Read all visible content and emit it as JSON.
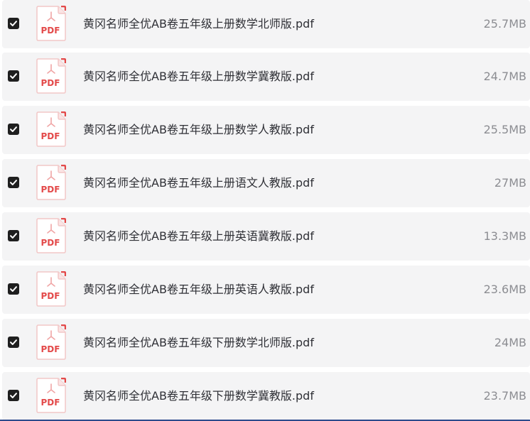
{
  "files": [
    {
      "name": "黄冈名师全优AB卷五年级上册数学北师版.pdf",
      "size": "25.7MB",
      "checked": true,
      "icon": "pdf-icon",
      "icon_text": "PDF"
    },
    {
      "name": "黄冈名师全优AB卷五年级上册数学冀教版.pdf",
      "size": "24.7MB",
      "checked": true,
      "icon": "pdf-icon",
      "icon_text": "PDF"
    },
    {
      "name": "黄冈名师全优AB卷五年级上册数学人教版.pdf",
      "size": "25.5MB",
      "checked": true,
      "icon": "pdf-icon",
      "icon_text": "PDF"
    },
    {
      "name": "黄冈名师全优AB卷五年级上册语文人教版.pdf",
      "size": "27MB",
      "checked": true,
      "icon": "pdf-icon",
      "icon_text": "PDF"
    },
    {
      "name": "黄冈名师全优AB卷五年级上册英语冀教版.pdf",
      "size": "13.3MB",
      "checked": true,
      "icon": "pdf-icon",
      "icon_text": "PDF"
    },
    {
      "name": "黄冈名师全优AB卷五年级上册英语人教版.pdf",
      "size": "23.6MB",
      "checked": true,
      "icon": "pdf-icon",
      "icon_text": "PDF"
    },
    {
      "name": "黄冈名师全优AB卷五年级下册数学北师版.pdf",
      "size": "24MB",
      "checked": true,
      "icon": "pdf-icon",
      "icon_text": "PDF"
    },
    {
      "name": "黄冈名师全优AB卷五年级下册数学冀教版.pdf",
      "size": "23.7MB",
      "checked": true,
      "icon": "pdf-icon",
      "icon_text": "PDF"
    }
  ],
  "colors": {
    "row_background": "#f4f4f5",
    "checkbox": "#1f1f1f",
    "pdf_accent": "#e34a4a",
    "filename_text": "#2f3036",
    "size_text": "#8c8d92"
  }
}
